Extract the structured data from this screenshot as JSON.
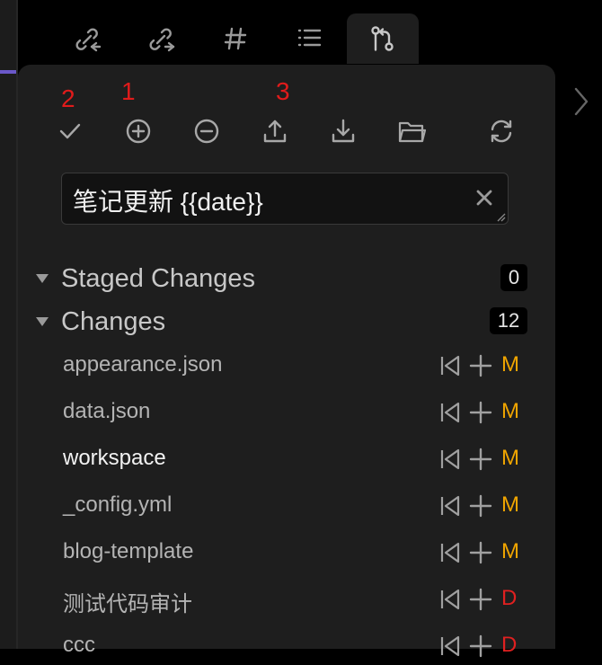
{
  "tabs": [
    {
      "icon": "backlinks-icon"
    },
    {
      "icon": "outgoing-links-icon"
    },
    {
      "icon": "tags-icon"
    },
    {
      "icon": "outline-icon"
    },
    {
      "icon": "source-control-icon",
      "active": true
    }
  ],
  "annotations": {
    "commit": "2",
    "stage_all": "1",
    "push": "3"
  },
  "toolbar": [
    "commit-icon",
    "stage-all-icon",
    "unstage-all-icon",
    "push-icon",
    "pull-icon",
    "open-folder-icon",
    "refresh-icon"
  ],
  "commit_message": {
    "value": "笔记更新 {{date}}"
  },
  "staged": {
    "title": "Staged Changes",
    "count": "0"
  },
  "changes": {
    "title": "Changes",
    "count": "12"
  },
  "files": [
    {
      "name": "appearance.json",
      "status": "M",
      "status_color": "#f0a500"
    },
    {
      "name": "data.json",
      "status": "M",
      "status_color": "#f0a500"
    },
    {
      "name": "workspace",
      "status": "M",
      "status_color": "#f0a500"
    },
    {
      "name": "_config.yml",
      "status": "M",
      "status_color": "#f0a500"
    },
    {
      "name": "blog-template",
      "status": "M",
      "status_color": "#f0a500"
    },
    {
      "name": "测试代码审计",
      "status": "D",
      "status_color": "#e02020"
    },
    {
      "name": "ccc",
      "status": "D",
      "status_color": "#e02020"
    }
  ],
  "colors": {
    "accent": "#6a58c9",
    "modified": "#f0a500",
    "deleted": "#e02020",
    "annotation": "#e01b1b"
  }
}
